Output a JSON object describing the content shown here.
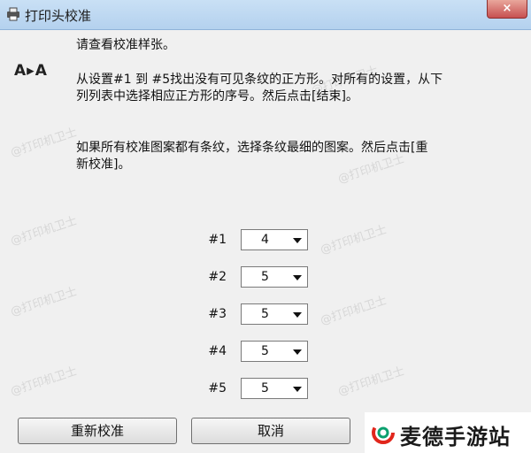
{
  "window": {
    "title": "打印头校准",
    "close_label": "×"
  },
  "instructions": {
    "line1": "请查看校准样张。",
    "aa_icon": "A▸A",
    "para1_line1": "从设置#1 到 #5找出没有可见条纹的正方形。对所有的设置，从下",
    "para1_line2": "列列表中选择相应正方形的序号。然后点击[结束]。",
    "para2_line1": "如果所有校准图案都有条纹，选择条纹最细的图案。然后点击[重",
    "para2_line2": "新校准]。"
  },
  "settings": [
    {
      "label": "#1",
      "value": "4"
    },
    {
      "label": "#2",
      "value": "5"
    },
    {
      "label": "#3",
      "value": "5"
    },
    {
      "label": "#4",
      "value": "5"
    },
    {
      "label": "#5",
      "value": "5"
    }
  ],
  "buttons": {
    "recalibrate": "重新校准",
    "cancel": "取消"
  },
  "watermark": "@打印机卫士",
  "brand": {
    "name": "麦德手游站",
    "accent": "#e1261c",
    "accent2": "#0aa06e"
  }
}
